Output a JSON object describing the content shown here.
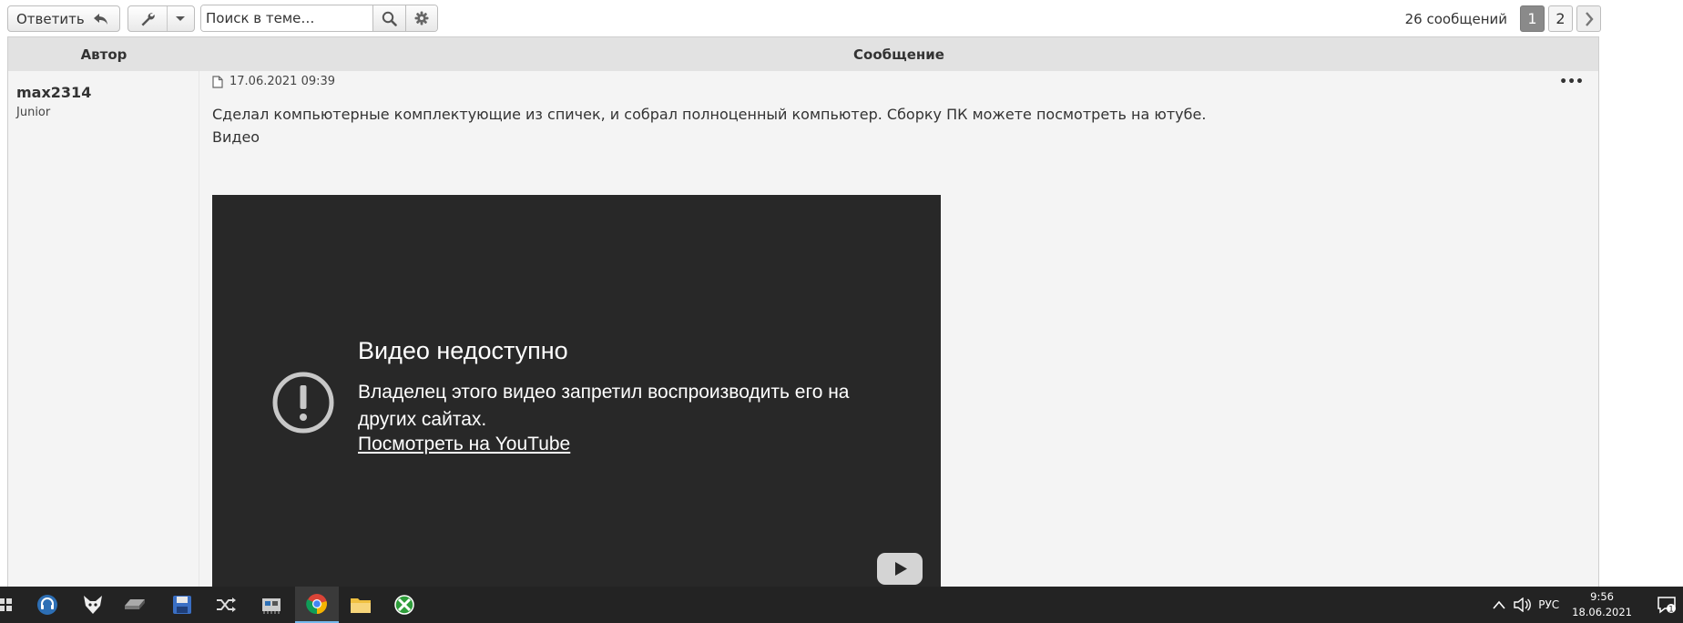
{
  "toolbar": {
    "reply_label": "Ответить",
    "search_placeholder": "Поиск в теме…",
    "post_count": "26 сообщений",
    "pages": [
      "1",
      "2"
    ],
    "active_page": "1"
  },
  "table": {
    "header_author": "Автор",
    "header_message": "Сообщение"
  },
  "post": {
    "author": "max2314",
    "rank": "Junior",
    "date": "17.06.2021 09:39",
    "text_line1": "Сделал компьютерные комплектующие из спичек, и собрал полноценный компьютер. Сборку ПК можете посмотреть на ютубе.",
    "text_line2": "Видео"
  },
  "video": {
    "title": "Видео недоступно",
    "description": "Владелец этого видео запретил воспроизводить его на других сайтах.",
    "link": "Посмотреть на YouTube",
    "background": "#282828"
  },
  "taskbar": {
    "icons": [
      "start-icon",
      "headset-icon",
      "fox-icon",
      "drive-icon",
      "save-icon",
      "shuffle-icon",
      "network-card-icon",
      "chrome-icon",
      "folder-icon",
      "xbox-icon"
    ],
    "active": "chrome-icon",
    "lang": "РУС",
    "time": "9:56",
    "date": "18.06.2021",
    "notifications": "1"
  }
}
